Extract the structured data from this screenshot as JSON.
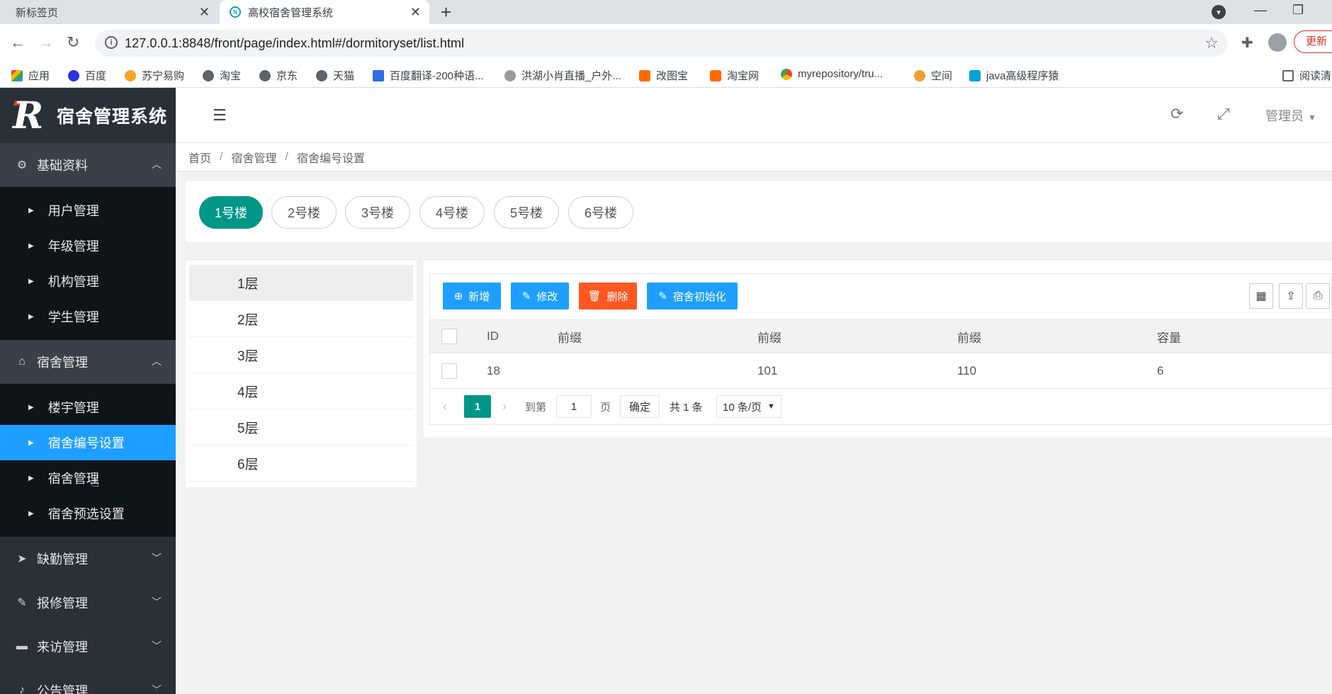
{
  "browser": {
    "tabs": [
      {
        "title": "新标签页"
      },
      {
        "title": "高校宿舍管理系统"
      }
    ],
    "url": "127.0.0.1:8848/front/page/index.html#/dormitoryset/list.html",
    "update_label": "更新",
    "bookmarks": [
      {
        "label": "应用",
        "color": "#e94235"
      },
      {
        "label": "百度",
        "color": "#2932e1"
      },
      {
        "label": "苏宁易购",
        "color": "#f5a623"
      },
      {
        "label": "淘宝",
        "color": "#5f6368"
      },
      {
        "label": "京东",
        "color": "#5f6368"
      },
      {
        "label": "天猫",
        "color": "#5f6368"
      },
      {
        "label": "百度翻译-200种语...",
        "color": "#2f6ee6"
      },
      {
        "label": "洪湖小肖直播_户外...",
        "color": "#777777"
      },
      {
        "label": "改图宝",
        "color": "#ff6a00"
      },
      {
        "label": "淘宝网",
        "color": "#ff6a00"
      },
      {
        "label": "myrepository/tru...",
        "color": "#34a853"
      },
      {
        "label": "空间",
        "color": "#f0a030"
      },
      {
        "label": "java高级程序猿",
        "color": "#00a1d6"
      },
      {
        "label": "阅读清",
        "color": "#5f6368"
      }
    ]
  },
  "app": {
    "logo_text": "宿舍管理系统",
    "header": {
      "user": "管理员"
    },
    "sidebar": {
      "groups": [
        {
          "label": "基础资料",
          "icon": "gear-icon",
          "items": [
            "用户管理",
            "年级管理",
            "机构管理",
            "学生管理"
          ]
        },
        {
          "label": "宿舍管理",
          "icon": "home-icon",
          "items": [
            "楼宇管理",
            "宿舍编号设置",
            "宿舍管理",
            "宿舍预选设置"
          ]
        },
        {
          "label": "缺勤管理",
          "icon": "compass-icon"
        },
        {
          "label": "报修管理",
          "icon": "wrench-icon"
        },
        {
          "label": "来访管理",
          "icon": "truck-icon"
        },
        {
          "label": "公告管理",
          "icon": "bell-icon"
        }
      ],
      "active_item": "宿舍编号设置"
    },
    "breadcrumb": [
      "首页",
      "宿舍管理",
      "宿舍编号设置"
    ],
    "buildings": [
      "1号楼",
      "2号楼",
      "3号楼",
      "4号楼",
      "5号楼",
      "6号楼"
    ],
    "active_building": "1号楼",
    "floors": [
      "1层",
      "2层",
      "3层",
      "4层",
      "5层",
      "6层"
    ],
    "active_floor": "1层",
    "toolbar": {
      "add": "新增",
      "edit": "修改",
      "delete": "删除",
      "init": "宿舍初始化"
    },
    "table": {
      "columns": [
        "ID",
        "前缀",
        "前缀",
        "前缀",
        "容量"
      ],
      "rows": [
        {
          "id": "18",
          "prefix": "",
          "start": "101",
          "end": "110",
          "capacity": "6"
        }
      ]
    },
    "pager": {
      "current": "1",
      "goto_label": "到第",
      "goto_value": "1",
      "page_label": "页",
      "confirm": "确定",
      "total": "共 1 条",
      "page_size": "10 条/页"
    },
    "colors": {
      "primary": "#009688",
      "blue": "#1e9fff",
      "danger": "#ff5722",
      "sidebar": "#2a3038"
    }
  }
}
